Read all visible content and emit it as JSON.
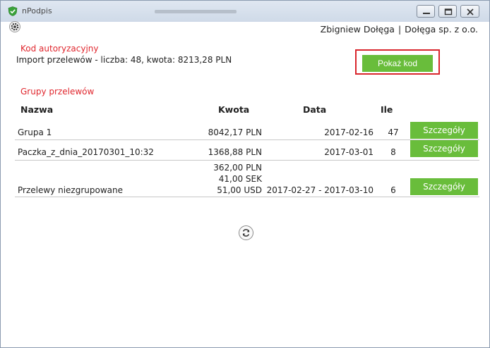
{
  "app": {
    "title": "nPodpis"
  },
  "user": {
    "name": "Zbigniew Dołęga",
    "separator": "|",
    "company": "Dołęga sp. z o.o."
  },
  "auth": {
    "title": "Kod autoryzacyjny",
    "import_summary": "Import przelewów - liczba: 48, kwota: 8213,28 PLN",
    "show_code_label": "Pokaż kod"
  },
  "groups": {
    "title": "Grupy przelewów",
    "headers": {
      "name": "Nazwa",
      "amount": "Kwota",
      "date": "Data",
      "count": "Ile"
    },
    "rows": [
      {
        "name": "Grupa 1",
        "amounts": [
          "8042,17 PLN"
        ],
        "date": "2017-02-16",
        "count": "47",
        "button": "Szczegóły"
      },
      {
        "name": "Paczka_z_dnia_20170301_10:32",
        "amounts": [
          "1368,88 PLN"
        ],
        "date": "2017-03-01",
        "count": "8",
        "button": "Szczegóły"
      },
      {
        "name": "Przelewy niezgrupowane",
        "amounts": [
          "362,00 PLN",
          "41,00 SEK",
          "51,00 USD"
        ],
        "date": "2017-02-27 - 2017-03-10",
        "count": "6",
        "button": "Szczegóły"
      }
    ]
  },
  "colors": {
    "accent_green": "#69bd3b",
    "section_red": "#e0262d",
    "highlight_border": "#d9252c"
  },
  "icons": {
    "app": "shield-check-icon",
    "settings": "gear-icon",
    "refresh": "refresh-icon"
  }
}
